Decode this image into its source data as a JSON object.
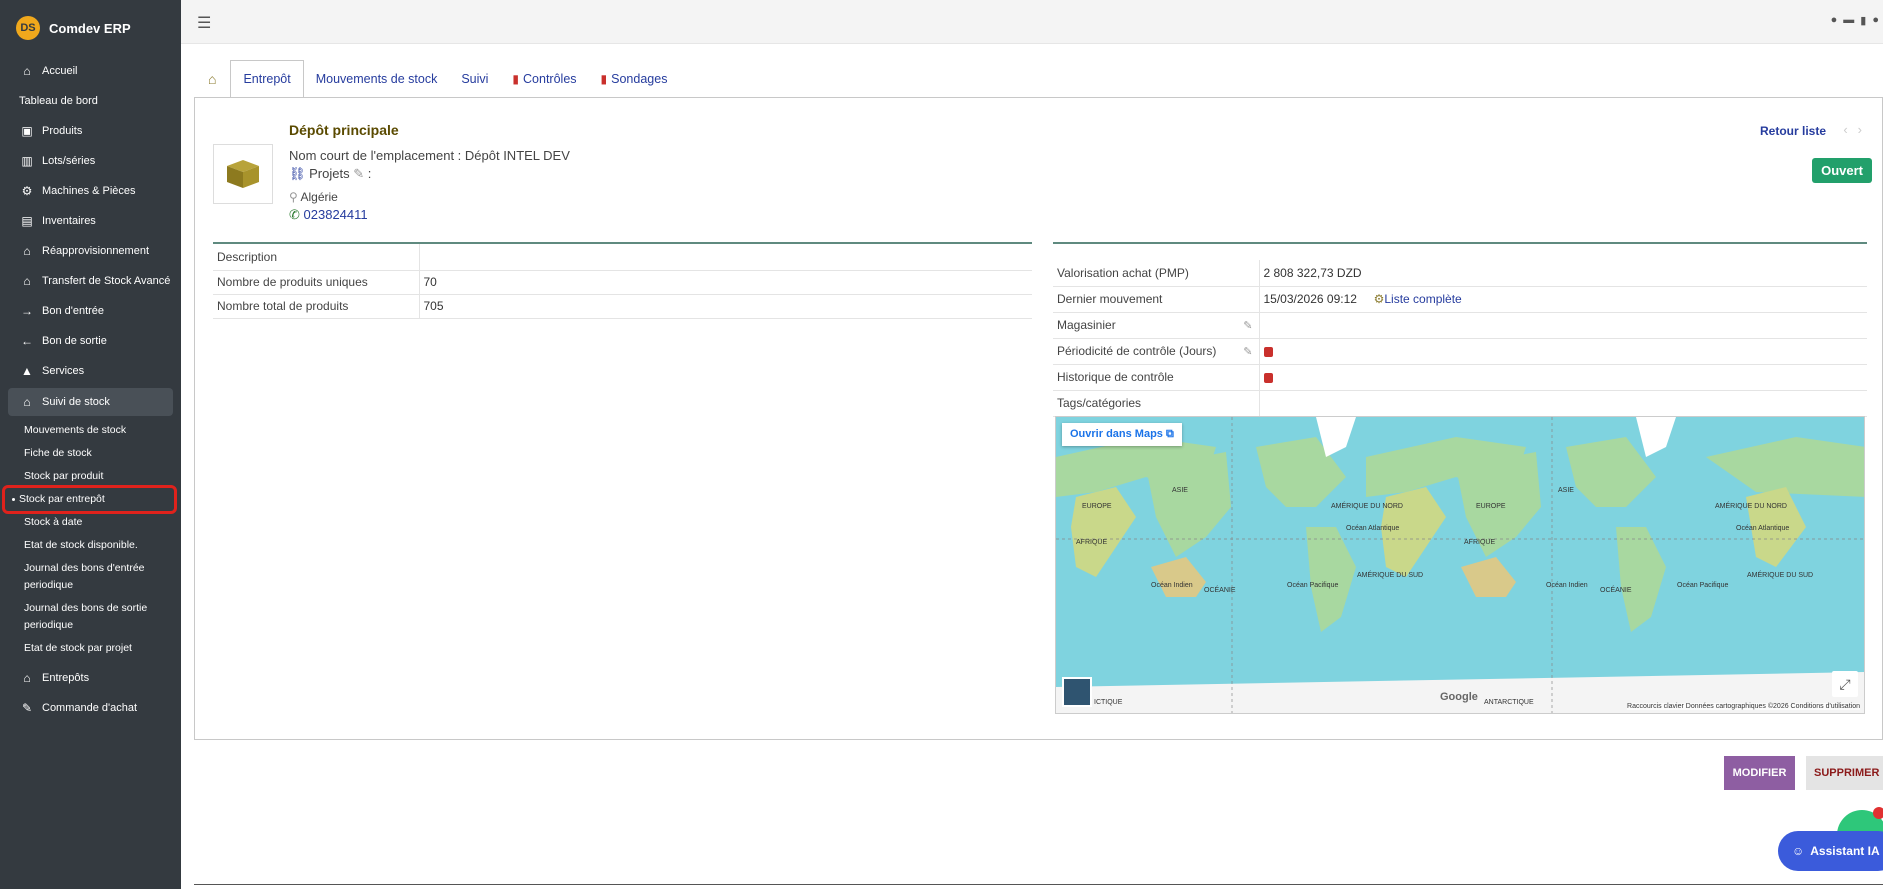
{
  "brand": {
    "logo": "DS",
    "name": "Comdev ERP"
  },
  "sidebar": {
    "items": [
      {
        "icon": "home-icon",
        "glyph": "⌂",
        "label": "Accueil"
      },
      {
        "icon": "",
        "glyph": "",
        "label": "Tableau de bord"
      },
      {
        "icon": "cube-icon",
        "glyph": "▣",
        "label": "Produits"
      },
      {
        "icon": "barcode-icon",
        "glyph": "▥",
        "label": "Lots/séries"
      },
      {
        "icon": "cogs-icon",
        "glyph": "⚙",
        "label": "Machines & Pièces"
      },
      {
        "icon": "boxes-icon",
        "glyph": "▤",
        "label": "Inventaires"
      },
      {
        "icon": "warehouse-icon",
        "glyph": "⌂",
        "label": "Réapprovisionnement"
      },
      {
        "icon": "warehouse-icon",
        "glyph": "⌂",
        "label": "Transfert de Stock Avancé"
      },
      {
        "icon": "arrow-right-icon",
        "glyph": "→",
        "label": "Bon d'entrée"
      },
      {
        "icon": "arrow-left-icon",
        "glyph": "←",
        "label": "Bon de sortie"
      },
      {
        "icon": "services-icon",
        "glyph": "▲",
        "label": "Services"
      },
      {
        "icon": "warehouse-icon",
        "glyph": "⌂",
        "label": "Suivi de stock"
      }
    ],
    "sub_items": [
      "Mouvements de stock",
      "Fiche de stock",
      "Stock par produit",
      "Stock par entrepôt",
      "Stock à date",
      "Etat de stock disponible.",
      "Journal des bons d'entrée periodique",
      "Journal des bons de sortie periodique",
      "Etat de stock par projet"
    ],
    "bottom_items": [
      {
        "icon": "warehouse-icon",
        "glyph": "⌂",
        "label": "Entrepôts"
      },
      {
        "icon": "cart-icon",
        "glyph": "✎",
        "label": "Commande d'achat"
      }
    ]
  },
  "tabs": {
    "icon": "warehouse-icon",
    "list": [
      {
        "label": "Entrepôt",
        "active": true,
        "icon": ""
      },
      {
        "label": "Mouvements de stock",
        "active": false,
        "icon": ""
      },
      {
        "label": "Suivi",
        "active": false,
        "icon": ""
      },
      {
        "label": "Contrôles",
        "active": false,
        "icon": "clipboard-check-icon"
      },
      {
        "label": "Sondages",
        "active": false,
        "icon": "clipboard-check-icon"
      }
    ]
  },
  "warehouse": {
    "title": "Dépôt principale",
    "short_name": "Nom court de l'emplacement : Dépôt INTEL DEV",
    "projects_label": "Projets",
    "projects_suffix": ":",
    "country": "Algérie",
    "phone": "023824411",
    "back_link": "Retour liste",
    "status": "Ouvert"
  },
  "left_table": [
    {
      "key": "Description",
      "value": ""
    },
    {
      "key": "Nombre de produits uniques",
      "value": "70"
    },
    {
      "key": "Nombre total de produits",
      "value": "705"
    }
  ],
  "right_table": {
    "valuation": {
      "key": "Valorisation achat (PMP)",
      "value": "2 808 322,73 DZD"
    },
    "last_movement": {
      "key": "Dernier mouvement",
      "value": "15/03/2026 09:12",
      "link": "Liste complète"
    },
    "storekeeper": {
      "key": "Magasinier"
    },
    "control_period": {
      "key": "Périodicité de contrôle (Jours)"
    },
    "control_history": {
      "key": "Historique de contrôle"
    },
    "tags": {
      "key": "Tags/catégories"
    }
  },
  "map": {
    "open_label": "Ouvrir dans Maps",
    "labels": [
      "ASIE",
      "EUROPE",
      "AFRIQUE",
      "AMÉRIQUE DU NORD",
      "Océan Atlantique",
      "Océan Indien",
      "OCÉANIE",
      "Océan Pacifique",
      "AMÉRIQUE DU SUD",
      "ANTARCTIQUE",
      "ASIE",
      "EUROPE",
      "AFRIQUE",
      "AMÉRIQUE DU NORD",
      "Océan Atlantique",
      "Océan Indien",
      "OCÉANIE",
      "Océan Pacifique",
      "AMÉRIQUE DU SUD",
      "ICTIQUE"
    ],
    "google": "Google",
    "footer": "Raccourcis clavier    Données cartographiques ©2026    Conditions d'utilisation"
  },
  "actions": {
    "modify": "MODIFIER",
    "delete": "SUPPRIMER"
  },
  "assistant": {
    "label": "Assistant IA"
  }
}
